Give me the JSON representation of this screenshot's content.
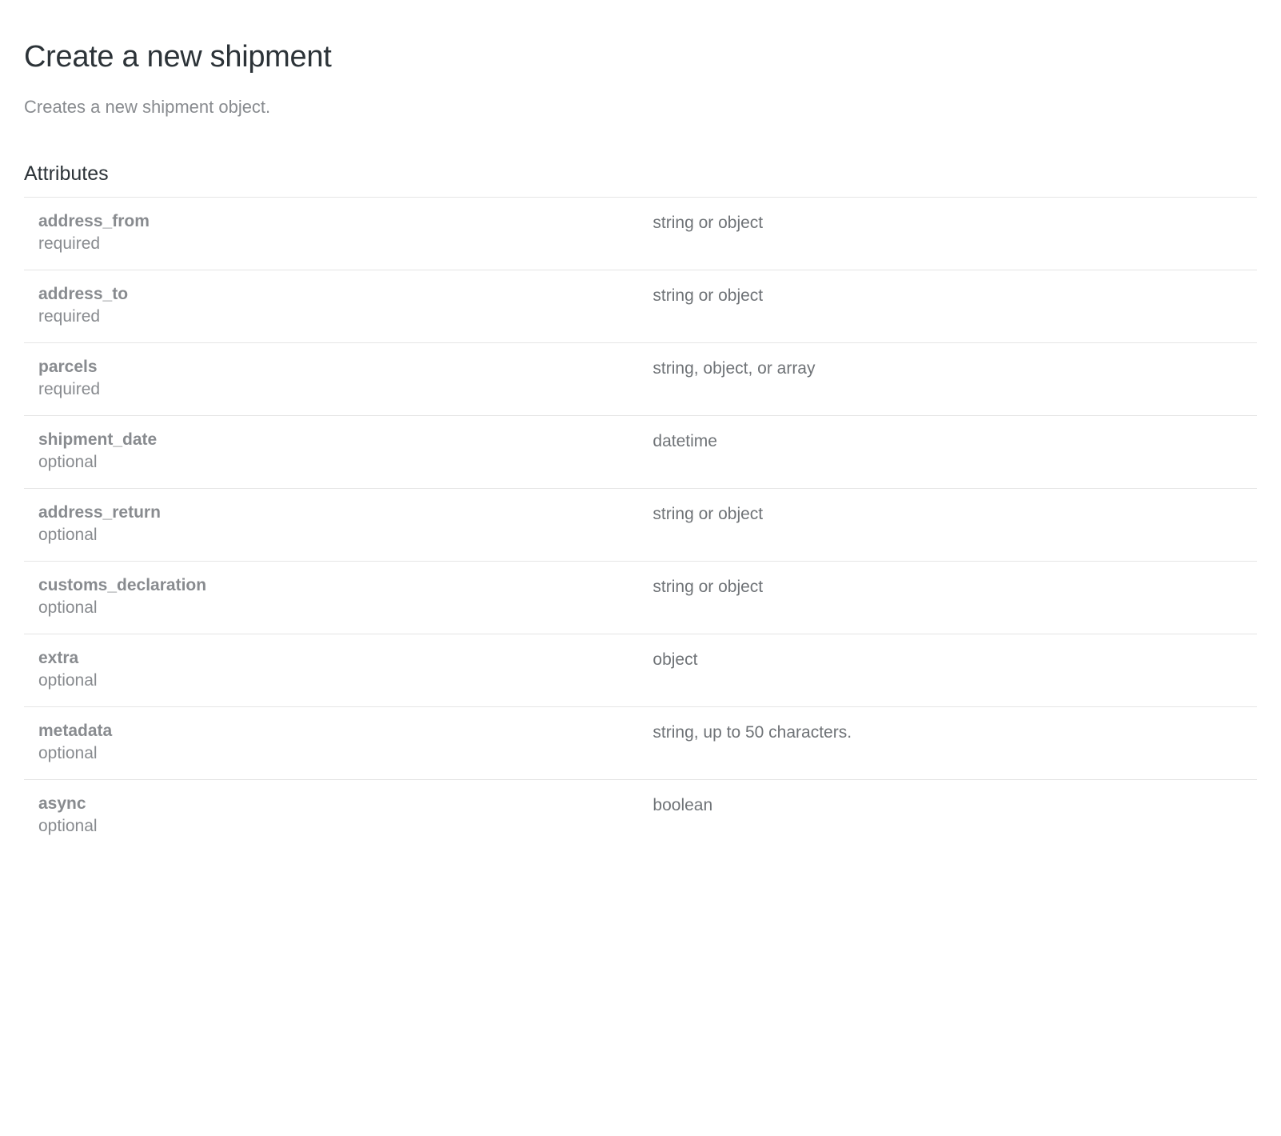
{
  "page": {
    "title": "Create a new shipment",
    "description": "Creates a new shipment object.",
    "section_title": "Attributes"
  },
  "attributes": [
    {
      "name": "address_from",
      "requirement": "required",
      "type": "string or object"
    },
    {
      "name": "address_to",
      "requirement": "required",
      "type": "string or object"
    },
    {
      "name": "parcels",
      "requirement": "required",
      "type": "string, object, or array"
    },
    {
      "name": "shipment_date",
      "requirement": "optional",
      "type": "datetime"
    },
    {
      "name": "address_return",
      "requirement": "optional",
      "type": "string or object"
    },
    {
      "name": "customs_declaration",
      "requirement": "optional",
      "type": "string or object"
    },
    {
      "name": "extra",
      "requirement": "optional",
      "type": "object"
    },
    {
      "name": "metadata",
      "requirement": "optional",
      "type": "string, up to 50 characters."
    },
    {
      "name": "async",
      "requirement": "optional",
      "type": "boolean"
    }
  ]
}
